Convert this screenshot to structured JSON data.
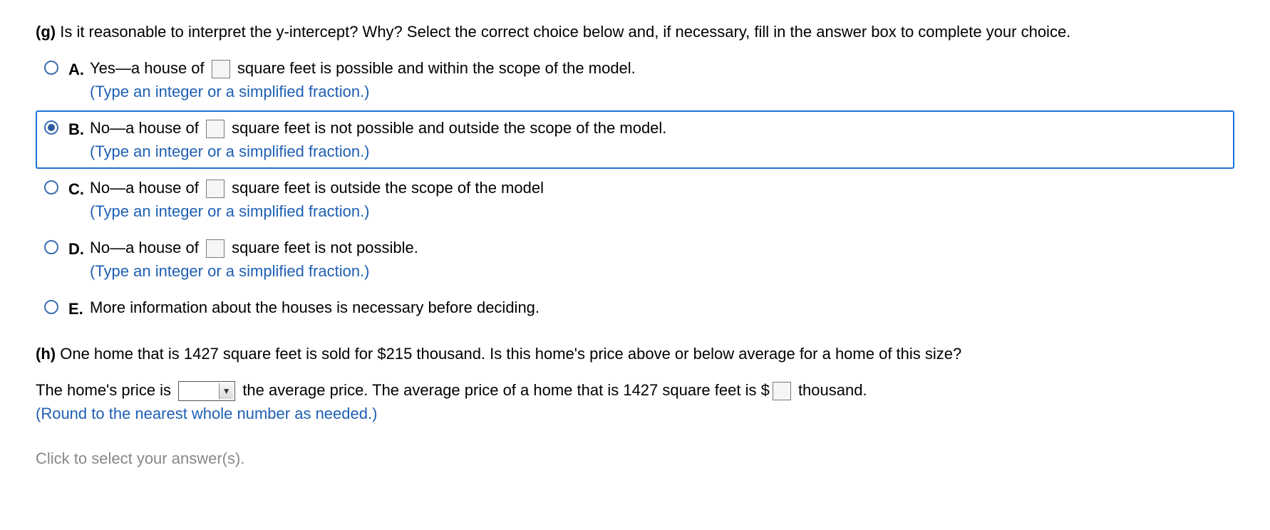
{
  "partG": {
    "label": "(g)",
    "prompt": "Is it reasonable to interpret the y-intercept? Why? Select the correct choice below and, if necessary, fill in the answer box to complete your choice.",
    "options": {
      "A": {
        "letter": "A.",
        "pre": "Yes—a house of",
        "post": "square feet is possible and within the scope of the model.",
        "hint": "(Type an integer or a simplified fraction.)",
        "selected": false,
        "hasInput": true
      },
      "B": {
        "letter": "B.",
        "pre": "No—a house of",
        "post": "square feet is not possible and outside the scope of the model.",
        "hint": "(Type an integer or a simplified fraction.)",
        "selected": true,
        "hasInput": true
      },
      "C": {
        "letter": "C.",
        "pre": "No—a house of",
        "post": "square feet is outside the scope of the model",
        "hint": "(Type an integer or a simplified fraction.)",
        "selected": false,
        "hasInput": true
      },
      "D": {
        "letter": "D.",
        "pre": "No—a house of",
        "post": "square feet is not possible.",
        "hint": "(Type an integer or a simplified fraction.)",
        "selected": false,
        "hasInput": true
      },
      "E": {
        "letter": "E.",
        "text": "More information about the houses is necessary before deciding.",
        "selected": false,
        "hasInput": false
      }
    }
  },
  "partH": {
    "label": "(h)",
    "prompt": "One home that is 1427 square feet is sold for $215 thousand. Is this home's price above or below average for a home of this size?",
    "answerPre": "The home's price is",
    "answerMid": "the average price. The average price of a home that is 1427 square feet is $",
    "answerPost": "thousand.",
    "hint": "(Round to the nearest whole number as needed.)"
  },
  "footer": "Click to select your answer(s)."
}
